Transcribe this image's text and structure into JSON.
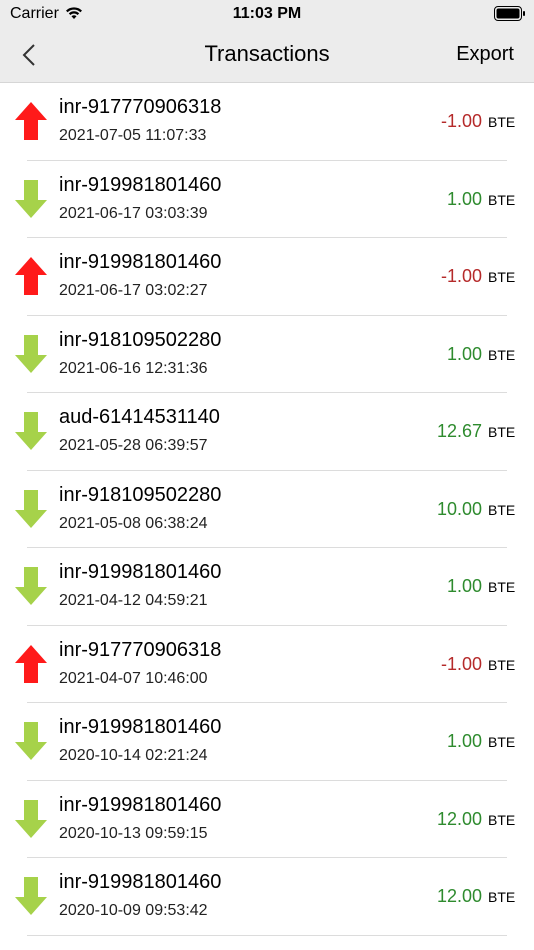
{
  "status": {
    "carrier": "Carrier",
    "time": "11:03 PM"
  },
  "nav": {
    "title": "Transactions",
    "export_label": "Export"
  },
  "colors": {
    "outgoing_arrow": "#ff1a1a",
    "incoming_arrow": "#a6d24a",
    "negative": "#b52a2a",
    "positive": "#2e8b2e"
  },
  "transactions": [
    {
      "direction": "out",
      "name": "inr-917770906318",
      "date": "2021-07-05 11:07:33",
      "amount": "-1.00",
      "unit": "BTE"
    },
    {
      "direction": "in",
      "name": "inr-919981801460",
      "date": "2021-06-17 03:03:39",
      "amount": "1.00",
      "unit": "BTE"
    },
    {
      "direction": "out",
      "name": "inr-919981801460",
      "date": "2021-06-17 03:02:27",
      "amount": "-1.00",
      "unit": "BTE"
    },
    {
      "direction": "in",
      "name": "inr-918109502280",
      "date": "2021-06-16 12:31:36",
      "amount": "1.00",
      "unit": "BTE"
    },
    {
      "direction": "in",
      "name": "aud-61414531140",
      "date": "2021-05-28 06:39:57",
      "amount": "12.67",
      "unit": "BTE"
    },
    {
      "direction": "in",
      "name": "inr-918109502280",
      "date": "2021-05-08 06:38:24",
      "amount": "10.00",
      "unit": "BTE"
    },
    {
      "direction": "in",
      "name": "inr-919981801460",
      "date": "2021-04-12 04:59:21",
      "amount": "1.00",
      "unit": "BTE"
    },
    {
      "direction": "out",
      "name": "inr-917770906318",
      "date": "2021-04-07 10:46:00",
      "amount": "-1.00",
      "unit": "BTE"
    },
    {
      "direction": "in",
      "name": "inr-919981801460",
      "date": "2020-10-14 02:21:24",
      "amount": "1.00",
      "unit": "BTE"
    },
    {
      "direction": "in",
      "name": "inr-919981801460",
      "date": "2020-10-13 09:59:15",
      "amount": "12.00",
      "unit": "BTE"
    },
    {
      "direction": "in",
      "name": "inr-919981801460",
      "date": "2020-10-09 09:53:42",
      "amount": "12.00",
      "unit": "BTE"
    }
  ]
}
